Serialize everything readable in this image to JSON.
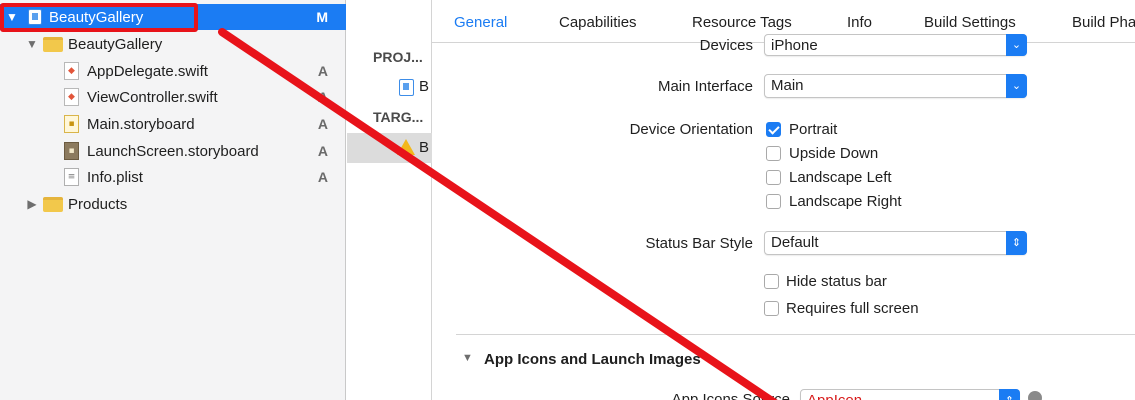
{
  "navigator": {
    "project_row": {
      "label": "BeautyGallery",
      "status": "M"
    },
    "folder_row": {
      "label": "BeautyGallery"
    },
    "files": [
      {
        "label": "AppDelegate.swift",
        "status": "A",
        "icon": "swift-file-icon"
      },
      {
        "label": "ViewController.swift",
        "status": "A",
        "icon": "swift-file-icon"
      },
      {
        "label": "Main.storyboard",
        "status": "A",
        "icon": "storyboard-file-icon"
      },
      {
        "label": "LaunchScreen.storyboard",
        "status": "A",
        "icon": "launchscreen-file-icon"
      },
      {
        "label": "Info.plist",
        "status": "A",
        "icon": "plist-file-icon"
      }
    ],
    "products_row": {
      "label": "Products"
    }
  },
  "targets": {
    "project_header": "PROJ...",
    "project_item": "B",
    "targets_header": "TARG...",
    "target_item": "B"
  },
  "tabs": [
    "General",
    "Capabilities",
    "Resource Tags",
    "Info",
    "Build Settings",
    "Build Pha"
  ],
  "settings": {
    "devices": {
      "label": "Devices",
      "value": "iPhone"
    },
    "main_interface": {
      "label": "Main Interface",
      "value": "Main"
    },
    "device_orientation": {
      "label": "Device Orientation",
      "options": [
        {
          "label": "Portrait",
          "checked": true
        },
        {
          "label": "Upside Down",
          "checked": false
        },
        {
          "label": "Landscape Left",
          "checked": false
        },
        {
          "label": "Landscape Right",
          "checked": false
        }
      ]
    },
    "status_bar_style": {
      "label": "Status Bar Style",
      "value": "Default"
    },
    "hide_status_bar": {
      "label": "Hide status bar",
      "checked": false
    },
    "requires_full_screen": {
      "label": "Requires full screen",
      "checked": false
    },
    "app_icons_section": {
      "title": "App Icons and Launch Images"
    },
    "app_icons_source": {
      "label": "App Icons Source",
      "value": "AppIcon"
    }
  },
  "colors": {
    "accent": "#1b7cf3",
    "annotation": "#e8131a",
    "navigator_bg": "#f4f4f5"
  }
}
